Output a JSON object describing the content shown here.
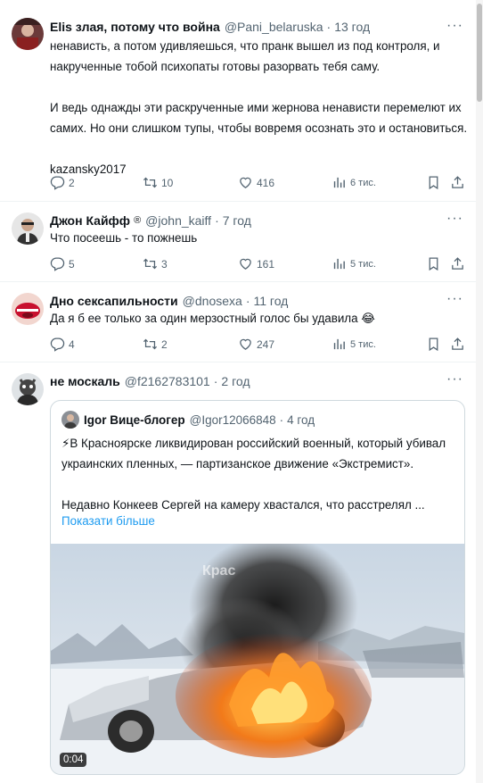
{
  "tweets": [
    {
      "name": "Elis злая, потому что война",
      "handle": "@Pani_belaruska",
      "time": "13 год",
      "text": "ненависть, а потом удивляешься, что пранк вышел из под контроля, и накрученные тобой психопаты готовы разорвать тебя саму.\n\nИ ведь однажды эти раскрученные ими жернова ненависти перемелют их самих. Но они слишком тупы, чтобы вовремя осознать это и остановиться.\n\nkazansky2017",
      "replies": "2",
      "retweets": "10",
      "likes": "416",
      "views": "6 тис."
    },
    {
      "name": "Джон Кайфф",
      "handle": "@john_kaiff",
      "time": "7 год",
      "text": "Что посеешь - то пожнешь",
      "replies": "5",
      "retweets": "3",
      "likes": "161",
      "views": "5 тис."
    },
    {
      "name": "Дно сексапильности",
      "handle": "@dnosexa",
      "time": "11 год",
      "text": "Да я б ее только за один мерзостный голос бы удавила 😂",
      "replies": "4",
      "retweets": "2",
      "likes": "247",
      "views": "5 тис."
    },
    {
      "name": "не москаль",
      "handle": "@f2162783101",
      "time": "2 год"
    }
  ],
  "badge_symbol": "®",
  "dot": "·",
  "more_icon": "···",
  "quote": {
    "name": "Igor Вице-блогер",
    "handle": "@Igor12066848",
    "time": "4 год",
    "text": "⚡В Красноярске ликвидирован российский военный, который убивал украинских пленных, — партизанское движение «Экстремист».\n\nНедавно Конкеев Сергей на камеру хвастался, что расстрелял ...",
    "show_more": "Показати більше",
    "video_duration": "0:04",
    "video_watermark": "Крас"
  },
  "colors": {
    "text": "#0f1419",
    "secondary": "#536471",
    "link": "#1d9bf0",
    "border": "#eff3f4"
  }
}
